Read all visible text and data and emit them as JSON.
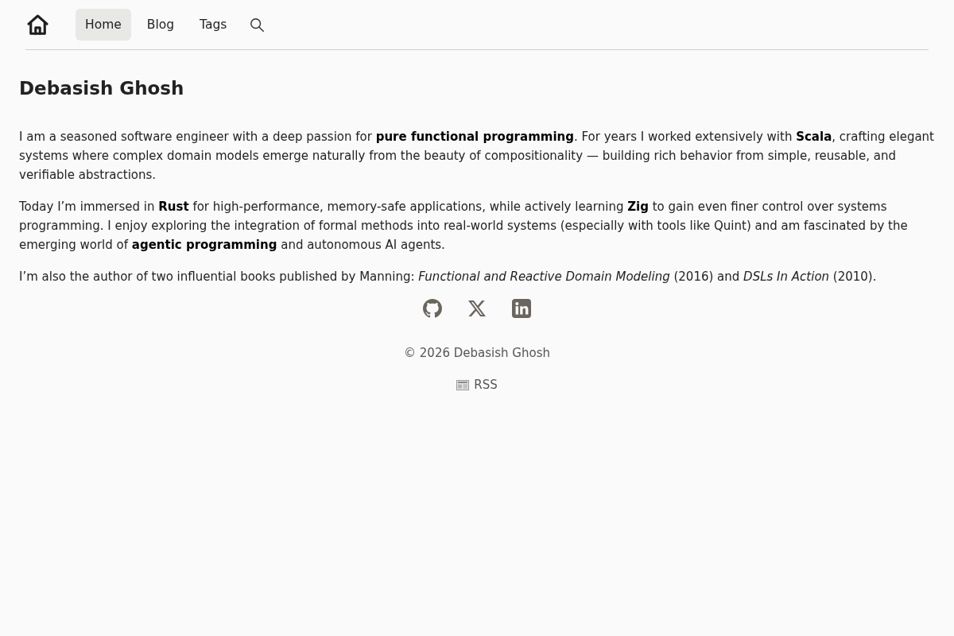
{
  "nav": {
    "items": [
      {
        "label": "Home",
        "selected": true
      },
      {
        "label": "Blog",
        "selected": false
      },
      {
        "label": "Tags",
        "selected": false
      }
    ]
  },
  "title": "Debasish Ghosh",
  "paragraphs": [
    "I am a seasoned software engineer with a deep passion for **pure functional programming**. For years I worked extensively with **Scala**, crafting elegant systems where complex domain models emerge naturally from the beauty of compositionality — building rich behavior from simple, reusable, and verifiable abstractions.",
    "Today I’m immersed in **Rust** for high-performance, memory-safe applications, while actively learning **Zig** to gain even finer control over systems programming. I enjoy exploring the integration of formal methods into real-world systems (especially with tools like Quint) and am fascinated by the emerging world of **agentic programming** and autonomous AI agents.",
    "I’m also the author of two influential books published by Manning: *Functional and Reactive Domain Modeling* (2016) and *DSLs In Action* (2010)."
  ],
  "social_links": [
    {
      "kind": "github"
    },
    {
      "kind": "x"
    },
    {
      "kind": "linkedin"
    }
  ],
  "footer": {
    "copyright": "© 2026 Debasish Ghosh",
    "rss_label": "RSS"
  }
}
